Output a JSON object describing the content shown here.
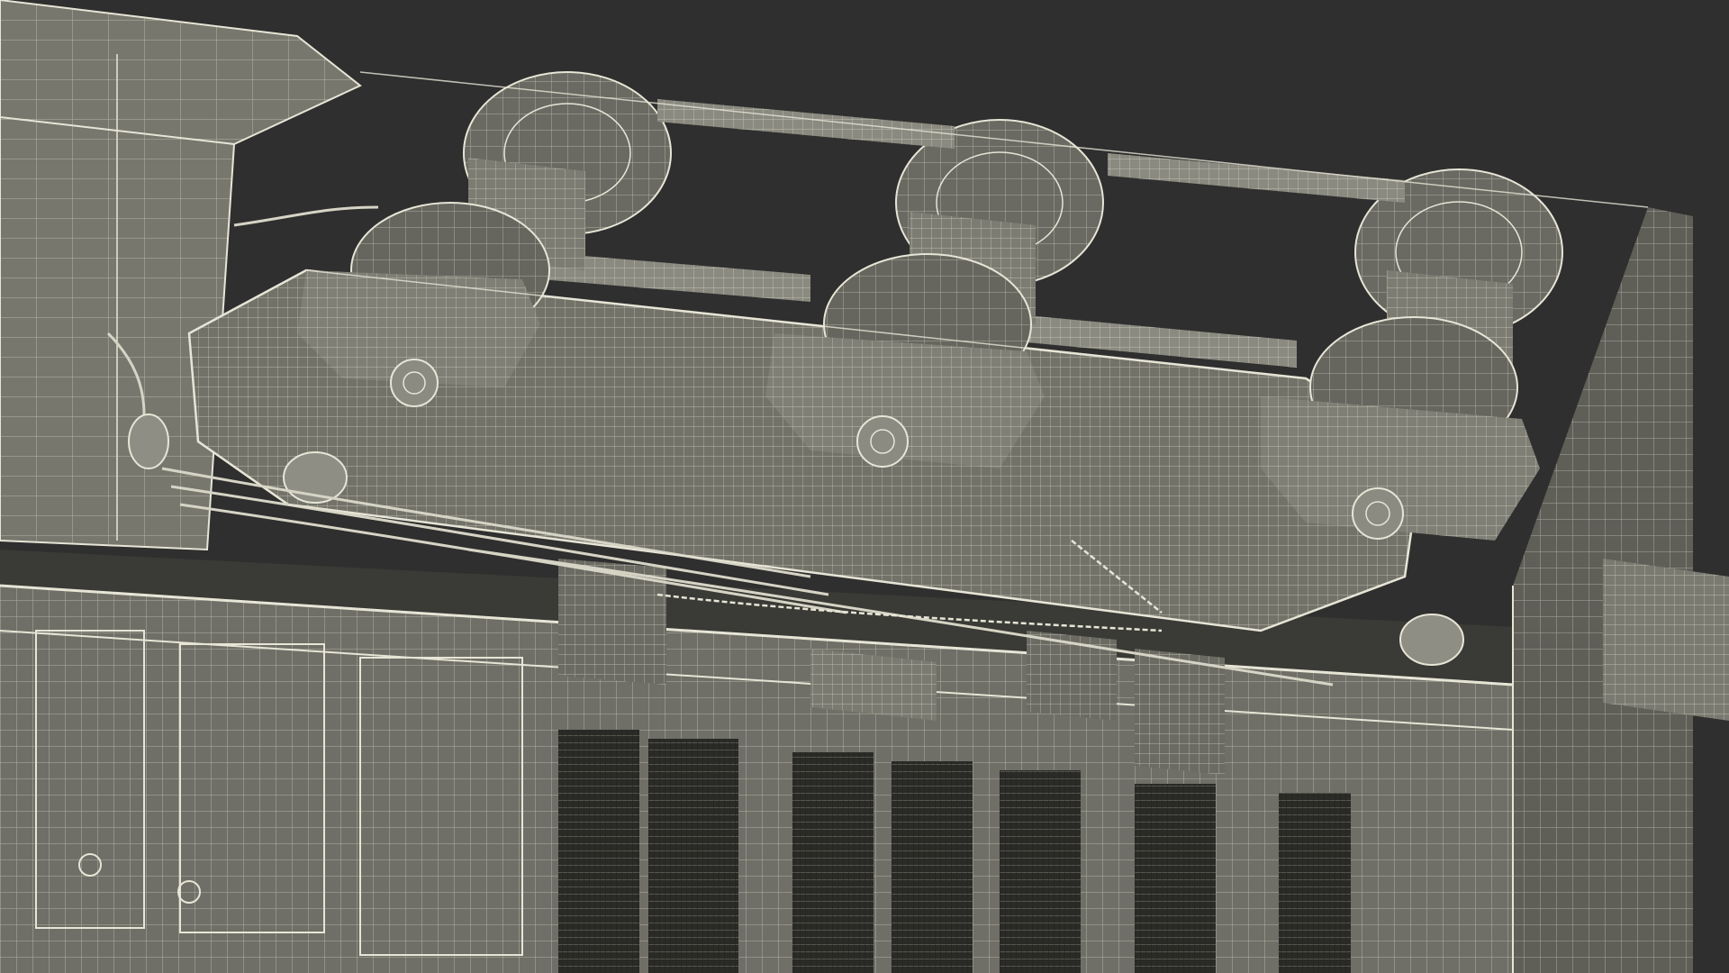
{
  "scene": {
    "subject": "wireframe-locomotive-bogie-render",
    "colors": {
      "background": "#2f2f2f",
      "surface": "#6e6e66",
      "surface_light": "#85857c",
      "surface_dark": "#4a4a44",
      "shadow": "#3b3b37",
      "wire": "#e7e5d6",
      "wire_dim": "#bdbbae"
    },
    "icons": {
      "wheel": "wheel-shape",
      "chain": "chain-shape"
    }
  }
}
